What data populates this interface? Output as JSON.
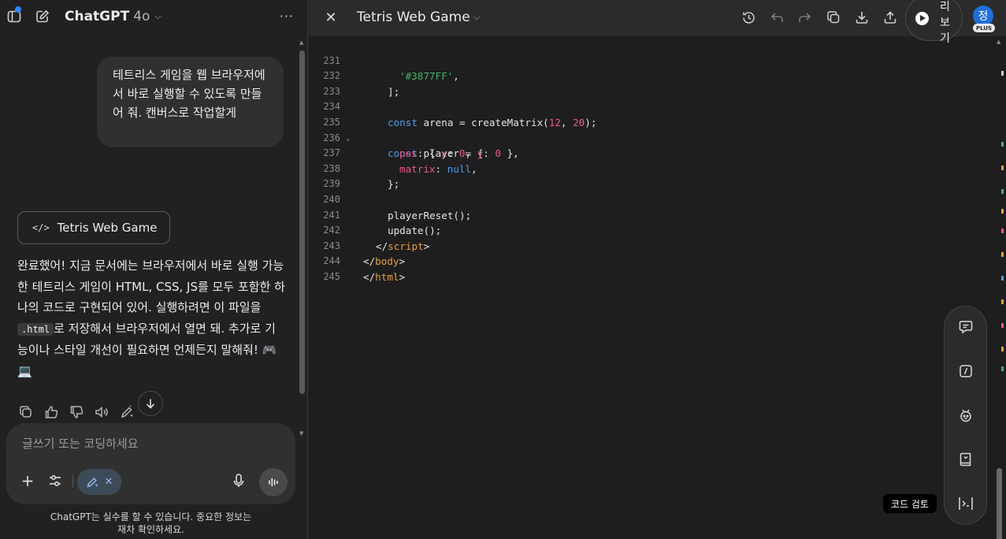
{
  "chat": {
    "model_name": "ChatGPT",
    "model_version": "4o",
    "user_message": "테트리스 게임을 웹 브라우저에서 바로 실행할 수 있도록 만들어 줘. 캔버스로 작업할게",
    "canvas_chip_label": "Tetris Web Game",
    "assistant_text_1": "완료했어! 지금 문서에는 브라우저에서 바로 실행 가능한 테트리스 게임이 HTML, CSS, JS를 모두 포함한 하나의 코드로 구현되어 있어. 실행하려면 이 파일을 ",
    "assistant_code": ".html",
    "assistant_text_2": "로 저장해서 브라우저에서 열면 돼. 추가로 기능이나 스타일 개선이 필요하면 언제든지 말해줘! 🎮💻",
    "composer_placeholder": "글쓰기 또는 코딩하세요",
    "disclaimer_line1": "ChatGPT는 실수를 할 수 있습니다. 중요한 정보는",
    "disclaimer_line2": "재차 확인하세요."
  },
  "canvas": {
    "title": "Tetris Web Game",
    "run_label": "리 보 기",
    "avatar_initial": "정",
    "plan_badge": "PLUS",
    "tooltip": "코드 검토",
    "accent_color": "#1e6fd9"
  },
  "code": {
    "line_numbers": [
      "231",
      "232",
      "233",
      "234",
      "235",
      "236",
      "237",
      "238",
      "239",
      "240",
      "241",
      "242",
      "243",
      "244",
      "245"
    ],
    "s231": "'#3877FF'",
    "l232": "];",
    "kw_const": "const",
    "l234_mid": " arena = createMatrix(",
    "n12": "12",
    "comma": ", ",
    "n20": "20",
    "l234_end": ");",
    "l235_mid": " player = {",
    "p_pos": "pos",
    "l236_a": ": { ",
    "p_x": "x",
    "colon": ": ",
    "n0": "0",
    "p_y": "y",
    "l236_end": " },",
    "p_matrix": "matrix",
    "null": "null",
    "l237_end": ",",
    "l238": "};",
    "l240": "playerReset();",
    "l241": "update();",
    "tag_script": "script",
    "tag_body": "body",
    "tag_html": "html",
    "close_open": "</",
    "gt": ">"
  },
  "icons": [
    "sidebar-icon",
    "new-chat-icon",
    "chevron-down-icon",
    "more-icon",
    "code-icon",
    "copy-icon",
    "thumbs-up-icon",
    "thumbs-down-icon",
    "speaker-icon",
    "edit-icon",
    "arrow-down-icon",
    "plus-icon",
    "tools-icon",
    "canvas-pencil-icon",
    "close-icon",
    "mic-icon",
    "voice-icon",
    "history-icon",
    "undo-icon",
    "redo-icon",
    "copy-icon",
    "download-icon",
    "share-icon",
    "play-icon",
    "comment-icon",
    "slash-icon",
    "bug-icon",
    "book-icon",
    "terminal-icon"
  ]
}
